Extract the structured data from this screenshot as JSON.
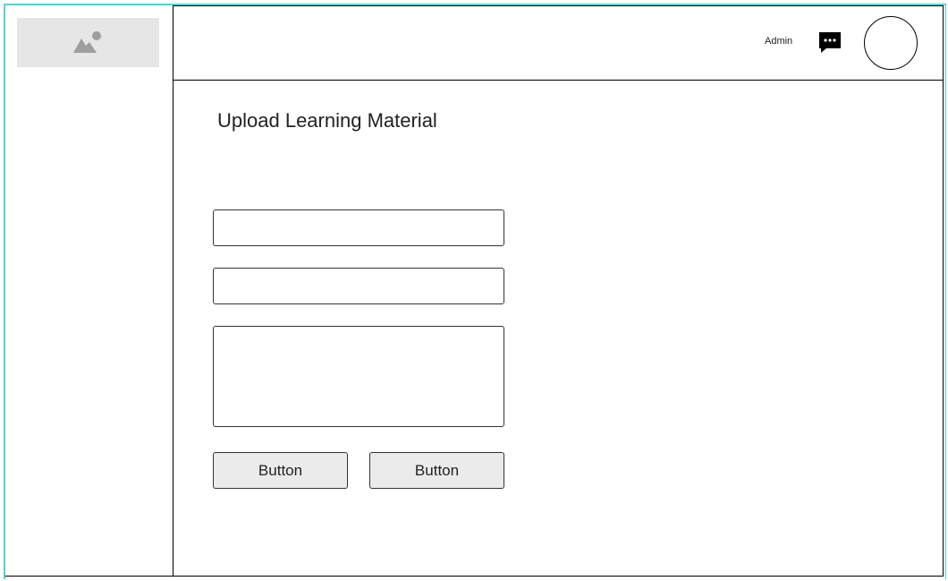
{
  "header": {
    "user_label": "Admin",
    "chat_icon": "chat-bubble-icon",
    "avatar_icon": "avatar-circle"
  },
  "sidebar": {
    "logo_icon": "image-placeholder-icon"
  },
  "main": {
    "title": "Upload Learning Material",
    "fields": [
      {
        "value": "",
        "placeholder": ""
      },
      {
        "value": "",
        "placeholder": ""
      },
      {
        "value": "",
        "placeholder": ""
      }
    ],
    "buttons": [
      {
        "label": "Button"
      },
      {
        "label": "Button"
      }
    ]
  },
  "colors": {
    "frame_accent": "#4fd1d9",
    "placeholder_bg": "#e6e6e6",
    "button_bg": "#ebebeb",
    "chat_icon": "#000000"
  }
}
